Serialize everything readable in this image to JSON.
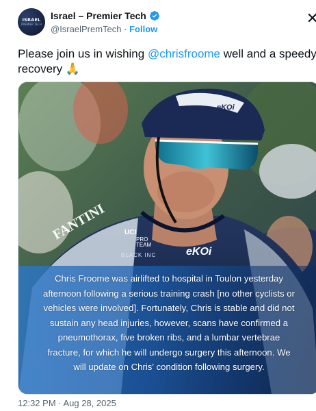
{
  "header": {
    "display_name": "Israel – Premier Tech",
    "handle": "@IsraelPremTech",
    "separator": "·",
    "follow_label": "Follow",
    "avatar_text_line1": "ISRAEL",
    "avatar_text_line2": "PREMIER TECH",
    "close_symbol": "✕"
  },
  "tweet": {
    "text_before": "Please join us in wishing ",
    "mention": "@chrisfroome",
    "text_after": "  well and a speedy",
    "line2": "recovery 🙏"
  },
  "media": {
    "jersey_sponsor_1": "FANTINI",
    "jersey_sponsor_2": "PRO",
    "jersey_sponsor_3": "TEAM",
    "jersey_sponsor_4": "BLACK INC",
    "jersey_sponsor_5": "eKOi",
    "jersey_sponsor_6": "UCI",
    "helmet_brand": "eKOi",
    "overlay_text": "Chris Froome was airlifted to hospital in Toulon yesterday\nafternoon following a serious training crash [no other cyclists or\nvehicles were involved]. Fortunately, Chris is stable and did not\nsustain any head injuries, however, scans have confirmed a\npneumothorax, five broken ribs, and a lumbar vertebrae\nfracture, for which he will undergo surgery this afternoon. We\nwill update on Chris' condition following surgery."
  },
  "footer": {
    "timestamp": "12:32 PM · Aug 28, 2025"
  },
  "colors": {
    "accent": "#1d9bf0",
    "text_primary": "#0f1419",
    "text_secondary": "#536471"
  }
}
